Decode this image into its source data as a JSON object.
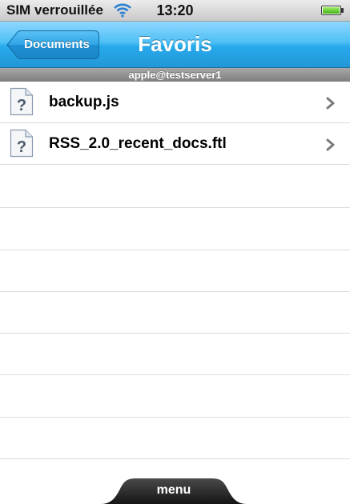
{
  "status_bar": {
    "carrier": "SIM verrouillée",
    "time": "13:20",
    "battery_level": 1.0
  },
  "nav": {
    "back_label": "Documents",
    "title": "Favoris"
  },
  "subtitle": "apple@testserver1",
  "files": [
    {
      "name": "backup.js",
      "icon": "unknown-file-icon"
    },
    {
      "name": "RSS_2.0_recent_docs.ftl",
      "icon": "unknown-file-icon"
    }
  ],
  "bottom": {
    "menu_label": "menu"
  },
  "colors": {
    "nav_blue": "#2ba9ea",
    "back_button": "#1a8fd6"
  }
}
